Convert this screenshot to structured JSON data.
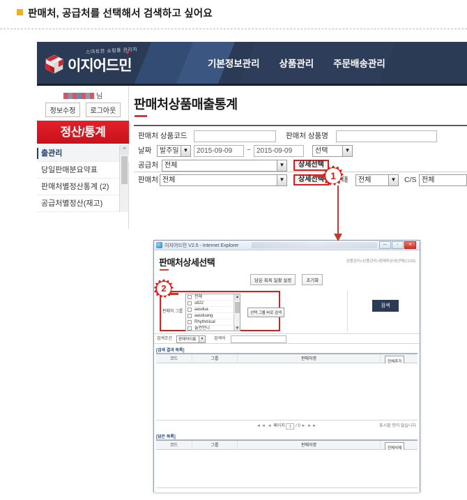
{
  "page": {
    "heading": "판매처, 공급처를 선택해서 검색하고 싶어요"
  },
  "header": {
    "brand": "이지어드민",
    "brand_tagline": "스마트한 쇼핑몰 관리자",
    "nav": [
      {
        "label": "기본정보관리"
      },
      {
        "label": "상품관리"
      },
      {
        "label": "주문배송관리"
      }
    ]
  },
  "sidebar": {
    "user_suffix": "님",
    "info_edit": "정보수정",
    "logout": "로그아웃",
    "section_title": "정산/통계",
    "menu": [
      {
        "label": "출관리"
      },
      {
        "label": "당일판매분요약표"
      },
      {
        "label": "판매처별정산통계 (2)"
      },
      {
        "label": "공급처별정산(재고)"
      }
    ]
  },
  "main": {
    "page_title": "판매처상품매출통계",
    "form": {
      "product_code_label": "판매처 상품코드",
      "product_code_value": "",
      "product_name_label": "판매처 상품명",
      "product_name_value": "",
      "date_label": "날짜",
      "date_type": "발주일",
      "date_from": "2015-09-09",
      "date_to": "2015-09-09",
      "date_tilde": "~",
      "date_preset": "선택",
      "supplier_label": "공급처",
      "supplier_value": "전체",
      "supplier_detail_btn": "상세선택",
      "seller_label": "판매처",
      "seller_value": "전체",
      "seller_detail_btn": "상세선택",
      "status_label": "상태",
      "status_value": "전체",
      "cs_label": "C/S",
      "cs_value": "전체"
    }
  },
  "callouts": {
    "one": "1",
    "two": "2"
  },
  "popup": {
    "window_title": "이지어드민 V2.5 - Internet Explorer",
    "win_minimize": "—",
    "win_maximize": "▫",
    "win_close": "✕",
    "title": "판매처상세선택",
    "breadcrumb": "상품관리>상품관리>판매처상세선택(C120)",
    "buttons": {
      "apply_list": "담은 목록 일괄 설정",
      "reset": "초기화",
      "group_search": "선택 그룹 바로 검색",
      "search": "검색"
    },
    "group": {
      "label": "판매처 그룹",
      "items": [
        {
          "label": "전체",
          "checked": false
        },
        {
          "label": "s822",
          "checked": false
        },
        {
          "label": "aasdua",
          "checked": false
        },
        {
          "label": "aasduang",
          "checked": false
        },
        {
          "label": "Rhythmical",
          "checked": false
        },
        {
          "label": "놀언언니",
          "checked": false
        }
      ],
      "scroll_up": "▲",
      "scroll_down": "▼"
    },
    "search_row": {
      "condition_label": "검색조건",
      "condition_value": "판매처이름",
      "keyword_label": "검색어",
      "keyword_value": ""
    },
    "result_section": {
      "label": "[검색 결과 목록]",
      "columns": [
        "코드",
        "그룹",
        "판매처명"
      ],
      "action_button": "전체추가",
      "rows": [],
      "pager": {
        "first": "◄◄",
        "prev": "◄",
        "page_label": "페이지",
        "page_value": "1",
        "total": "/ 0",
        "next": "►",
        "last": "►►",
        "empty_text": "표시할 항이 없습니다"
      }
    },
    "basket_section": {
      "label": "[담은 목록]",
      "columns": [
        "코드",
        "그룹",
        "판매처명"
      ],
      "action_button": "전체삭제",
      "rows": []
    }
  },
  "colors": {
    "accent_red": "#e11b1b",
    "header_navy": "#2b3a55",
    "section_red": "#d8121b",
    "marker_yellow": "#f2b01e"
  }
}
